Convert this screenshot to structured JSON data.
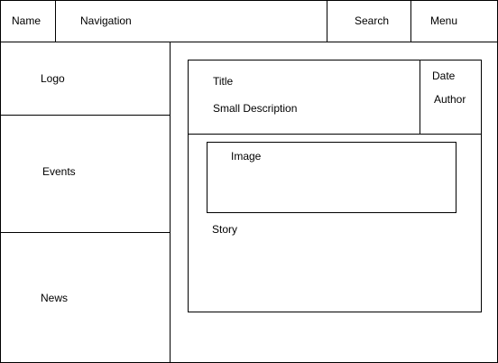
{
  "header": {
    "name": "Name",
    "navigation": "Navigation",
    "search": "Search",
    "menu": "Menu"
  },
  "sidebar": {
    "logo": "Logo",
    "events": "Events",
    "news": "News"
  },
  "article": {
    "title": "Title",
    "small_description": "Small Description",
    "date": "Date",
    "author": "Author",
    "image": "Image",
    "story": "Story"
  }
}
